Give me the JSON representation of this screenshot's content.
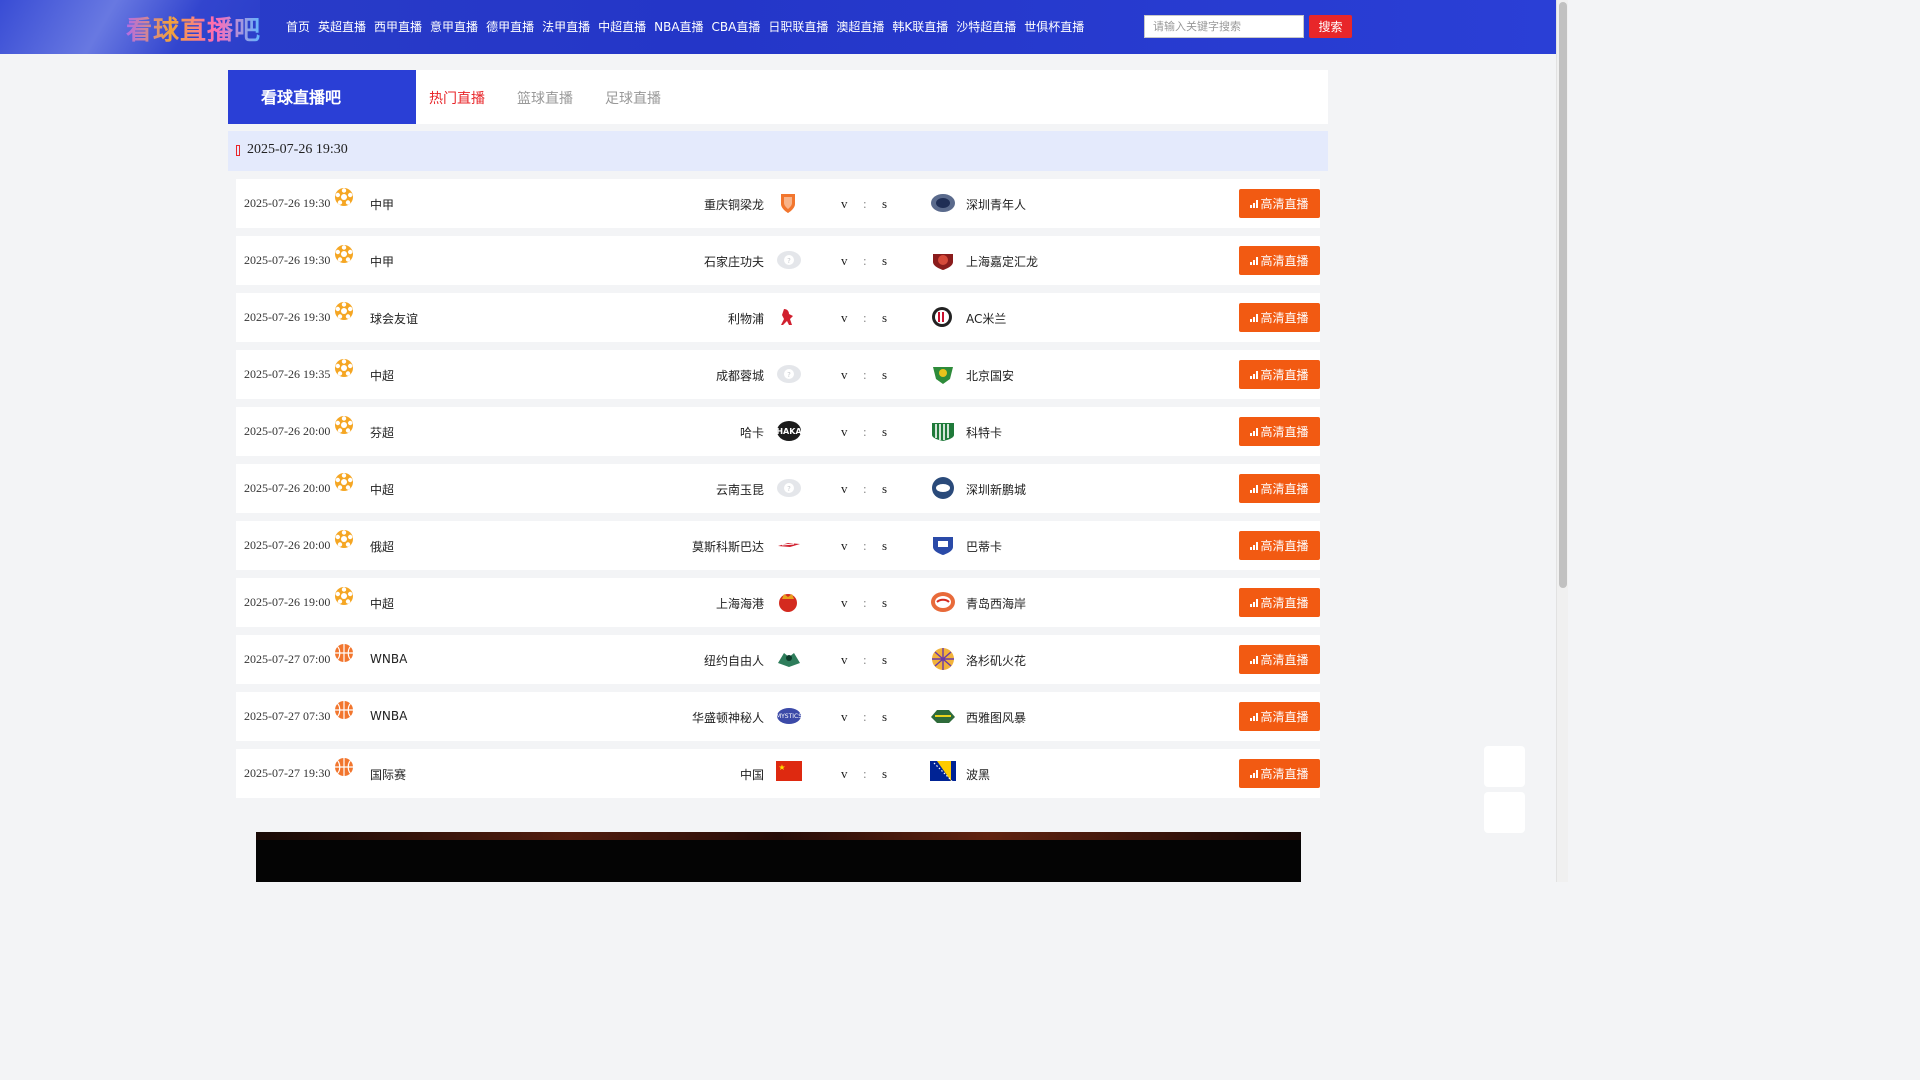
{
  "header": {
    "logo_text": "看球直播吧",
    "nav": [
      "首页",
      "英超直播",
      "西甲直播",
      "意甲直播",
      "德甲直播",
      "法甲直播",
      "中超直播",
      "NBA直播",
      "CBA直播",
      "日职联直播",
      "澳超直播",
      "韩K联直播",
      "沙特超直播",
      "世俱杯直播"
    ],
    "search_placeholder": "请输入关键字搜索",
    "search_button": "搜索"
  },
  "tabs": {
    "brand": "看球直播吧",
    "items": [
      "热门直播",
      "篮球直播",
      "足球直播"
    ],
    "active": "热门直播"
  },
  "date_header": "2025-07-26 19:30",
  "match_labels": {
    "vs_left": "v",
    "vs_colon": ":",
    "vs_right": "s",
    "live_button": "高清直播"
  },
  "matches": [
    {
      "time": "2025-07-26 19:30",
      "sport": "football",
      "league": "中甲",
      "home": "重庆铜梁龙",
      "away": "深圳青年人"
    },
    {
      "time": "2025-07-26 19:30",
      "sport": "football",
      "league": "中甲",
      "home": "石家庄功夫",
      "away": "上海嘉定汇龙"
    },
    {
      "time": "2025-07-26 19:30",
      "sport": "football",
      "league": "球会友谊",
      "home": "利物浦",
      "away": "AC米兰"
    },
    {
      "time": "2025-07-26 19:35",
      "sport": "football",
      "league": "中超",
      "home": "成都蓉城",
      "away": "北京国安"
    },
    {
      "time": "2025-07-26 20:00",
      "sport": "football",
      "league": "芬超",
      "home": "哈卡",
      "away": "科特卡"
    },
    {
      "time": "2025-07-26 20:00",
      "sport": "football",
      "league": "中超",
      "home": "云南玉昆",
      "away": "深圳新鹏城"
    },
    {
      "time": "2025-07-26 20:00",
      "sport": "football",
      "league": "俄超",
      "home": "莫斯科斯巴达",
      "away": "巴蒂卡"
    },
    {
      "time": "2025-07-26 19:00",
      "sport": "football",
      "league": "中超",
      "home": "上海海港",
      "away": "青岛西海岸"
    },
    {
      "time": "2025-07-27 07:00",
      "sport": "basketball",
      "league": "WNBA",
      "home": "纽约自由人",
      "away": "洛杉矶火花"
    },
    {
      "time": "2025-07-27 07:30",
      "sport": "basketball",
      "league": "WNBA",
      "home": "华盛顿神秘人",
      "away": "西雅图风暴"
    },
    {
      "time": "2025-07-27 19:30",
      "sport": "basketball",
      "league": "国际赛",
      "home": "中国",
      "away": "波黑"
    }
  ],
  "colors": {
    "header_blue": "#2a3fd6",
    "accent_red": "#e8262a",
    "live_orange": "#f25a12",
    "date_bar": "#e4eafc"
  },
  "icons": {
    "football": "football-icon",
    "basketball": "basketball-icon",
    "live": "signal-bars-icon"
  }
}
